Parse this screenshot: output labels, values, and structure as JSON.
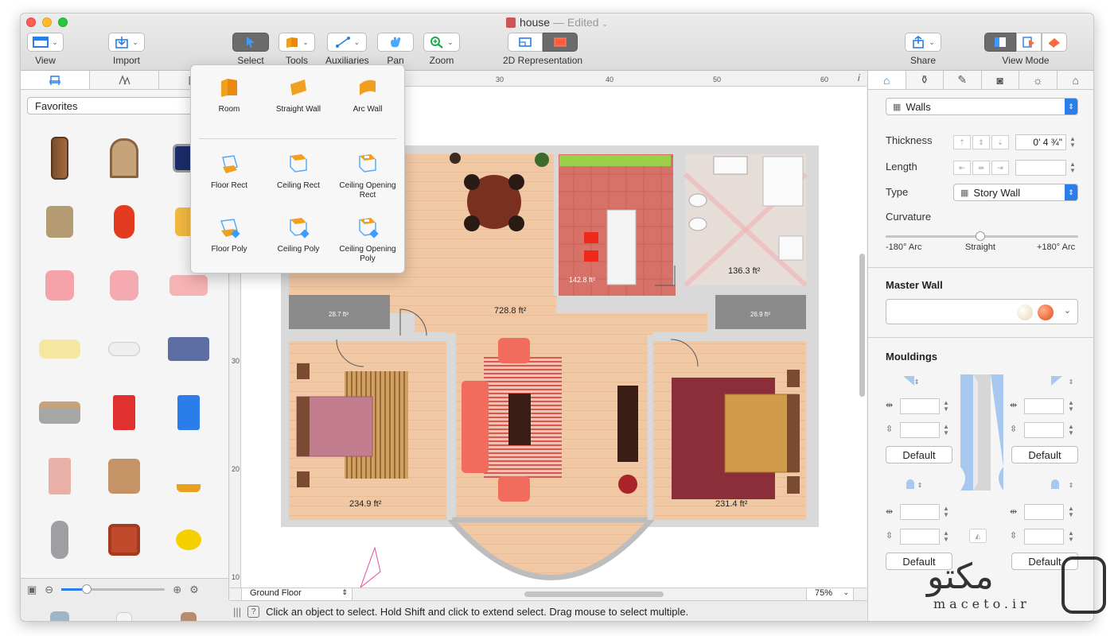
{
  "window": {
    "title": "house",
    "edited": "— Edited"
  },
  "toolbar": {
    "view": "View",
    "import": "Import",
    "select": "Select",
    "tools": "Tools",
    "auxiliaries": "Auxiliaries",
    "pan": "Pan",
    "zoom": "Zoom",
    "representation": "2D Representation",
    "share": "Share",
    "view_mode": "View Mode"
  },
  "tools_menu": {
    "items": [
      "Room",
      "Straight Wall",
      "Arc Wall",
      "Floor Rect",
      "Ceiling Rect",
      "Ceiling Opening Rect",
      "Floor Poly",
      "Ceiling Poly",
      "Ceiling Opening Poly"
    ]
  },
  "library": {
    "category": "Favorites"
  },
  "canvas": {
    "ruler_top": [
      "30",
      "40",
      "50",
      "60"
    ],
    "ruler_left": [
      "30",
      "20",
      "10"
    ],
    "rooms": {
      "living": "728.8 ft²",
      "kitchen": "142.8 ft²",
      "bath": "136.3 ft²",
      "closet_left": "28.7 ft²",
      "closet_right": "26.9 ft²",
      "bed_left": "234.9 ft²",
      "bed_right": "231.4 ft²"
    },
    "floor": "Ground Floor",
    "zoom": "75%",
    "info": "i"
  },
  "status": {
    "text": "Click an object to select. Hold Shift and click to extend select. Drag mouse to select multiple."
  },
  "inspector": {
    "object_type": "Walls",
    "thickness_label": "Thickness",
    "thickness_value": "0' 4 ¾\"",
    "length_label": "Length",
    "type_label": "Type",
    "type_value": "Story Wall",
    "curvature_label": "Curvature",
    "curv_left": "-180° Arc",
    "curv_mid": "Straight",
    "curv_right": "+180° Arc",
    "master_wall": "Master Wall",
    "mouldings": "Mouldings",
    "default": "Default"
  },
  "watermark": {
    "brand": "مکتو",
    "domain": "maceto.ir"
  },
  "colors": {
    "accent": "#2b7de9",
    "floor": "#f0c8a4",
    "kitchen": "#d77268",
    "bath": "#e6dcd8",
    "wall": "#d9d9d9"
  }
}
